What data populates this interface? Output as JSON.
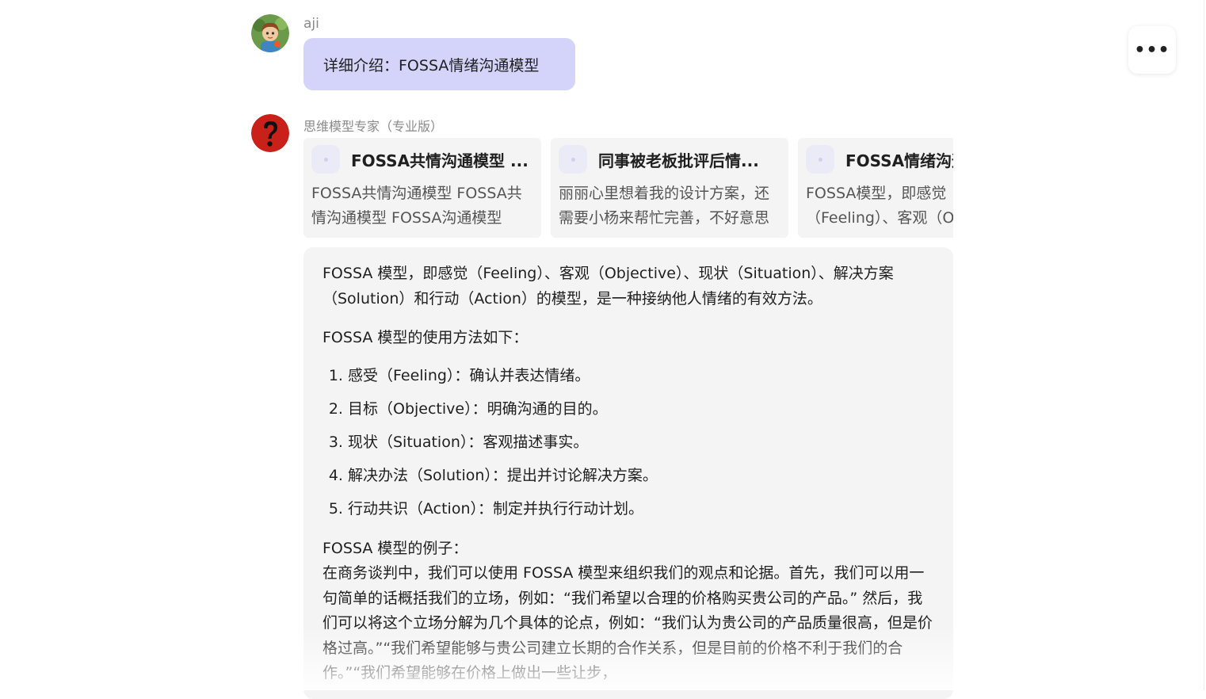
{
  "toolbar": {
    "more_icon": "ellipsis-icon",
    "more_label": "•••"
  },
  "user_message": {
    "sender": "aji",
    "avatar_icon": "user-avatar-icon",
    "text": "详细介绍：FOSSA情绪沟通模型"
  },
  "bot_message": {
    "sender": "思维模型专家（专业版）",
    "avatar_icon": "question-mark-icon",
    "avatar_color": "#c9201a",
    "reference_cards": [
      {
        "title": "FOSSA共情沟通模型 ...",
        "snippet": "FOSSA共情沟通模型 FOSSA共情沟通模型 FOSSA沟通模型"
      },
      {
        "title": "同事被老板批评后情...",
        "snippet": "丽丽心里想着我的设计方案，还需要小杨来帮忙完善，不好意思"
      },
      {
        "title": "FOSSA情绪沟通模型",
        "snippet": "FOSSA模型，即感觉（Feeling）、客观（Objective）"
      }
    ],
    "answer": {
      "intro": "FOSSA 模型，即感觉（Feeling）、客观（Objective）、现状（Situation）、解决方案（Solution）和行动（Action）的模型，是一种接纳他人情绪的有效方法。",
      "usage_heading": "FOSSA 模型的使用方法如下：",
      "steps": [
        "感受（Feeling）：确认并表达情绪。",
        "目标（Objective）：明确沟通的目的。",
        "现状（Situation）：客观描述事实。",
        "解决办法（Solution）：提出并讨论解决方案。",
        "行动共识（Action）：制定并执行行动计划。"
      ],
      "example_heading": "FOSSA 模型的例子：",
      "example_text": "在商务谈判中，我们可以使用 FOSSA 模型来组织我们的观点和论据。首先，我们可以用一句简单的话概括我们的立场，例如：“我们希望以合理的价格购买贵公司的产品。” 然后，我们可以将这个立场分解为几个具体的论点，例如：“我们认为贵公司的产品质量很高，但是价格过高。”“我们希望能够与贵公司建立长期的合作关系，但是目前的价格不利于我们的合作。”“我们希望能够在价格上做出一些让步，"
    }
  }
}
